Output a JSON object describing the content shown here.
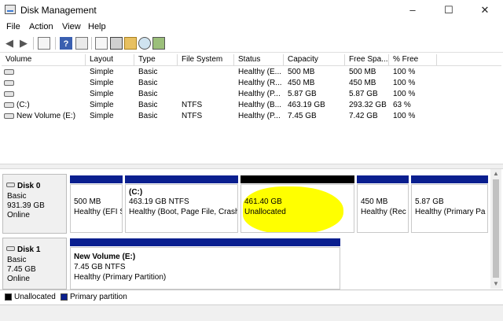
{
  "window": {
    "title": "Disk Management",
    "minimize": "–",
    "maximize": "☐",
    "close": "✕"
  },
  "menu": [
    "File",
    "Action",
    "View",
    "Help"
  ],
  "volumes": {
    "columns": [
      "Volume",
      "Layout",
      "Type",
      "File System",
      "Status",
      "Capacity",
      "Free Spa...",
      "% Free"
    ],
    "rows": [
      [
        "",
        "Simple",
        "Basic",
        "",
        "Healthy (E...",
        "500 MB",
        "500 MB",
        "100 %"
      ],
      [
        "",
        "Simple",
        "Basic",
        "",
        "Healthy (R...",
        "450 MB",
        "450 MB",
        "100 %"
      ],
      [
        "",
        "Simple",
        "Basic",
        "",
        "Healthy (P...",
        "5.87 GB",
        "5.87 GB",
        "100 %"
      ],
      [
        "(C:)",
        "Simple",
        "Basic",
        "NTFS",
        "Healthy (B...",
        "463.19 GB",
        "293.32 GB",
        "63 %"
      ],
      [
        "New Volume (E:)",
        "Simple",
        "Basic",
        "NTFS",
        "Healthy (P...",
        "7.45 GB",
        "7.42 GB",
        "100 %"
      ]
    ]
  },
  "disks": [
    {
      "name": "Disk 0",
      "type": "Basic",
      "size": "931.39 GB",
      "state": "Online",
      "partitions": [
        {
          "title": "",
          "line1": "500 MB",
          "line2": "Healthy (EFI S"
        },
        {
          "title": "(C:)",
          "line1": "463.19 GB NTFS",
          "line2": "Healthy (Boot, Page File, Crash"
        },
        {
          "title": "",
          "line1": "461.40 GB",
          "line2": "Unallocated"
        },
        {
          "title": "",
          "line1": "450 MB",
          "line2": "Healthy (Rec"
        },
        {
          "title": "",
          "line1": "5.87 GB",
          "line2": "Healthy (Primary Pa"
        }
      ]
    },
    {
      "name": "Disk 1",
      "type": "Basic",
      "size": "7.45 GB",
      "state": "Online",
      "partitions": [
        {
          "title": "New Volume  (E:)",
          "line1": "7.45 GB NTFS",
          "line2": "Healthy (Primary Partition)"
        }
      ]
    }
  ],
  "legend": [
    "Unallocated",
    "Primary partition"
  ],
  "colors": {
    "primary": "#0a1f8f",
    "unallocated": "#000000",
    "highlight": "#ffff00"
  }
}
